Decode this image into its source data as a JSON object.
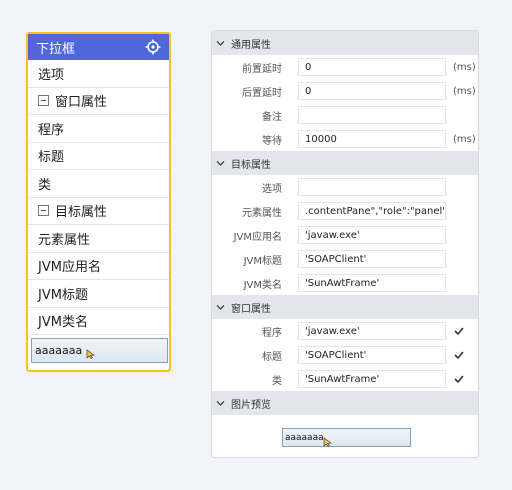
{
  "dropdown": {
    "header_title": "下拉框",
    "items": [
      {
        "label": "选项"
      },
      {
        "label": "窗口属性",
        "group": true
      },
      {
        "label": "程序"
      },
      {
        "label": "标题"
      },
      {
        "label": "类"
      },
      {
        "label": "目标属性",
        "group": true
      },
      {
        "label": "元素属性"
      },
      {
        "label": "JVM应用名"
      },
      {
        "label": "JVM标题"
      },
      {
        "label": "JVM类名"
      }
    ],
    "preview_text": "aaaaaaa"
  },
  "panel": {
    "general": {
      "title": "通用属性",
      "pre_delay_label": "前置延时",
      "pre_delay_value": "0",
      "pre_delay_unit": "(ms)",
      "post_delay_label": "后置延时",
      "post_delay_value": "0",
      "post_delay_unit": "(ms)",
      "remark_label": "备注",
      "remark_value": "",
      "wait_label": "等待",
      "wait_value": "10000",
      "wait_unit": "(ms)"
    },
    "target": {
      "title": "目标属性",
      "option_label": "选项",
      "option_value": "",
      "element_label": "元素属性",
      "element_value": ".contentPane\",\"role\":\"panel\"}]",
      "jvm_app_label": "JVM应用名",
      "jvm_app_value": "'javaw.exe'",
      "jvm_title_label": "JVM标题",
      "jvm_title_value": "'SOAPClient'",
      "jvm_class_label": "JVM类名",
      "jvm_class_value": "'SunAwtFrame'"
    },
    "window": {
      "title": "窗口属性",
      "program_label": "程序",
      "program_value": "'javaw.exe'",
      "title_label": "标题",
      "title_value": "'SOAPClient'",
      "class_label": "类",
      "class_value": "'SunAwtFrame'"
    },
    "image_preview": {
      "title": "图片预览",
      "preview_text": "aaaaaaa"
    }
  },
  "colors": {
    "header_blue": "#4f67d8",
    "highlight_border": "#f7c31a",
    "section_bg": "#e4e6ee"
  },
  "icons": [
    "crosshair-icon",
    "minus-box-icon",
    "chevron-down-icon",
    "checkmark-icon",
    "mouse-cursor-icon"
  ]
}
